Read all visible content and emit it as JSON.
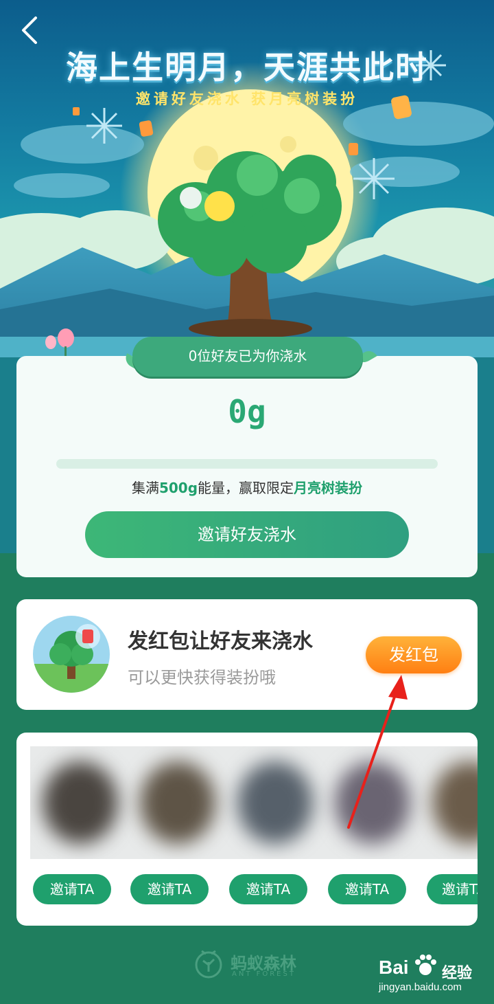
{
  "header": {
    "back_icon": "chevron-left-icon",
    "title": "海上生明月，天涯共此时",
    "subtitle": "邀请好友浇水  获月亮树装扮"
  },
  "progress_card": {
    "ribbon_text": "0位好友已为你浇水",
    "energy_value": "0g",
    "progress_fraction": 0,
    "goal_prefix": "集满",
    "goal_amount": "500g",
    "goal_middle": "能量，赢取限定",
    "goal_reward": "月亮树装扮",
    "invite_button": "邀请好友浇水"
  },
  "red_packet_card": {
    "title": "发红包让好友来浇水",
    "subtitle": "可以更快获得装扮哦",
    "button": "发红包"
  },
  "friends_card": {
    "invite_buttons": [
      "邀请TA",
      "邀请TA",
      "邀请TA",
      "邀请TA",
      "邀请TA"
    ]
  },
  "footer": {
    "brand_name": "蚂蚁森林",
    "brand_en": "ANT FOREST",
    "watermark": "Bai",
    "watermark_cn": "经验",
    "watermark_url": "jingyan.baidu.com"
  },
  "colors": {
    "primary_green": "#1fa06d",
    "accent_orange": "#ff8a1c",
    "background_green": "#1f7e5e"
  }
}
